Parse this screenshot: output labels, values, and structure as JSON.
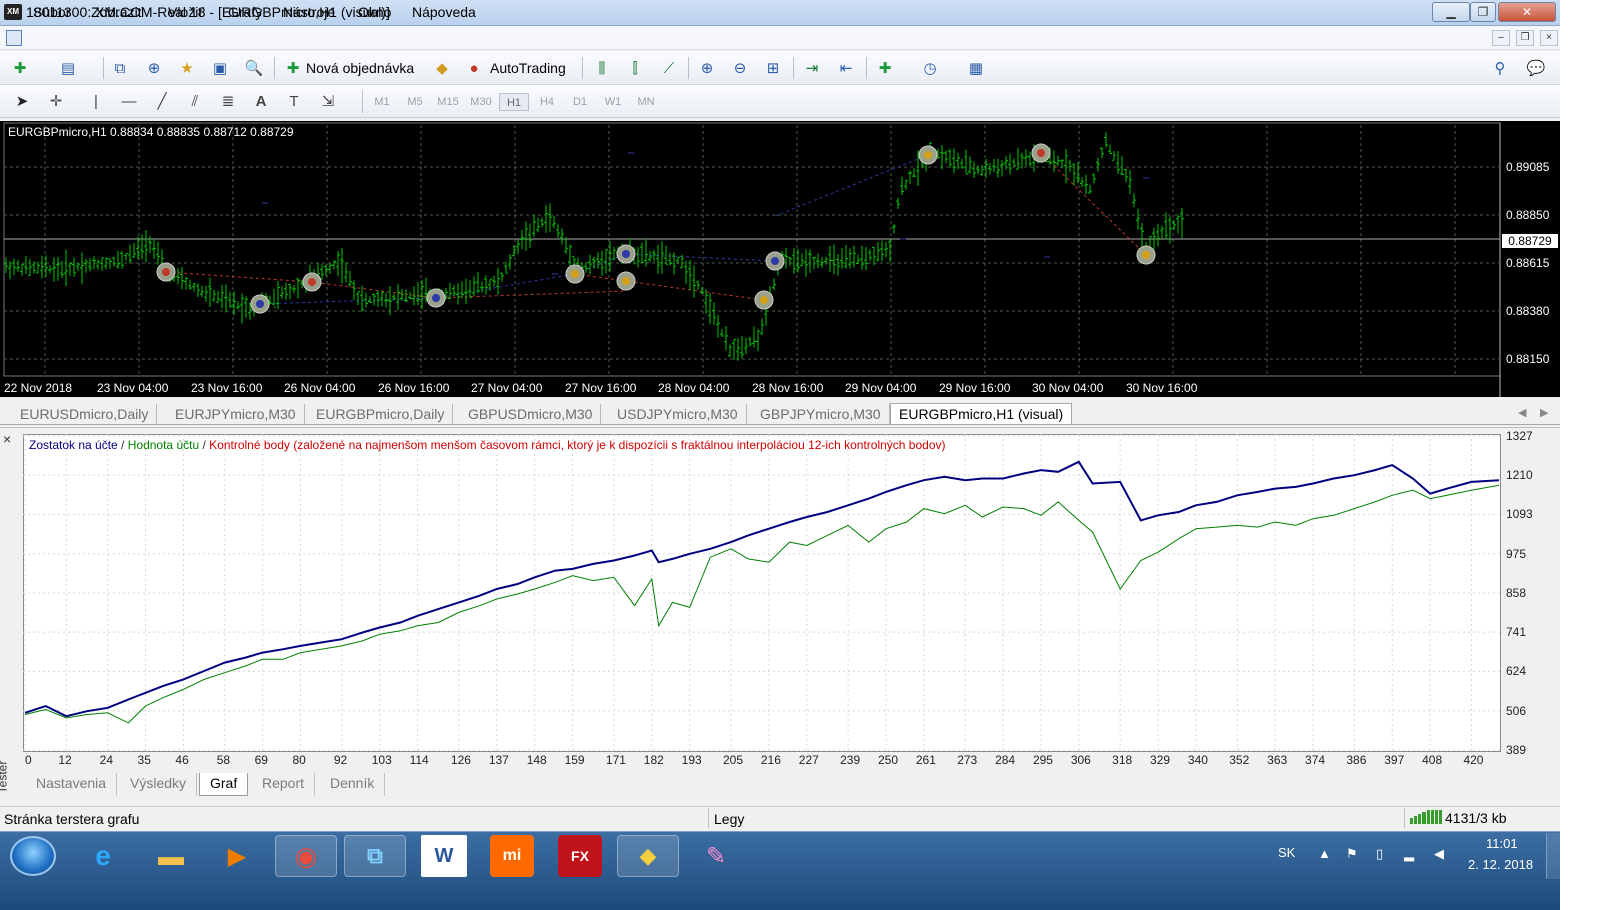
{
  "window": {
    "app_icon": "XM",
    "title": "18011300: XM.COM-Real 18 - [EURGBPmicro,H1 (visual)]",
    "minimize_icon": "minimize-icon",
    "maximize_icon": "maximize-icon",
    "close_icon": "close-icon"
  },
  "menu": {
    "items": [
      "Súbor",
      "Zobraziť",
      "Vložiť",
      "Grafy",
      "Nástroje",
      "Okno",
      "Nápoveda"
    ]
  },
  "toolbar": {
    "new_order_label": "Nová objednávka",
    "autotrading_label": "AutoTrading",
    "timeframes": [
      "M1",
      "M5",
      "M15",
      "M30",
      "H1",
      "H4",
      "D1",
      "W1",
      "MN"
    ],
    "active_timeframe": "H1",
    "text_tool": "A"
  },
  "chart": {
    "info": "EURGBPmicro,H1  0.88834 0.88835 0.88712 0.88729",
    "current_price": "0.88729",
    "price_levels": [
      "0.89085",
      "0.88850",
      "0.88615",
      "0.88380",
      "0.88150"
    ],
    "time_labels": [
      "22 Nov 2018",
      "23 Nov 04:00",
      "23 Nov 16:00",
      "26 Nov 04:00",
      "26 Nov 16:00",
      "27 Nov 04:00",
      "27 Nov 16:00",
      "28 Nov 04:00",
      "28 Nov 16:00",
      "29 Nov 04:00",
      "29 Nov 16:00",
      "30 Nov 04:00",
      "30 Nov 16:00"
    ],
    "colors": {
      "background": "#000000",
      "bull": "#00c800",
      "grid": "#3a4a3a",
      "text": "#ffffff"
    }
  },
  "chart_tabs": [
    "EURUSDmicro,Daily",
    "EURJPYmicro,M30",
    "EURGBPmicro,Daily",
    "GBPUSDmicro,M30",
    "USDJPYmicro,M30",
    "GBPJPYmicro,M30",
    "EURGBPmicro,H1 (visual)"
  ],
  "active_chart_tab": "EURGBPmicro,H1 (visual)",
  "tester": {
    "side_label": "Tester",
    "close_icon": "×",
    "legend": {
      "balance": "Zostatok na účte",
      "equity": "Hodnota účtu",
      "control": "Kontrolné body (založené na najmenšom menšom časovom rámci, ktorý je k dispozícii s fraktálnou interpoláciou 12-ich kontrolných bodov)",
      "separator": " / "
    },
    "tabs": [
      "Nastavenia",
      "Výsledky",
      "Graf",
      "Report",
      "Denník"
    ],
    "active_tab": "Graf"
  },
  "chart_data": {
    "type": "line",
    "title": "",
    "xlabel": "",
    "ylabel": "",
    "x_ticks": [
      0,
      12,
      24,
      35,
      46,
      58,
      69,
      80,
      92,
      103,
      114,
      126,
      137,
      148,
      159,
      171,
      182,
      193,
      205,
      216,
      227,
      239,
      250,
      261,
      273,
      284,
      295,
      306,
      318,
      329,
      340,
      352,
      363,
      374,
      386,
      397,
      408,
      420
    ],
    "y_ticks": [
      1327,
      1210,
      1093,
      975,
      858,
      741,
      624,
      506,
      389
    ],
    "xlim": [
      0,
      428
    ],
    "ylim": [
      389,
      1327
    ],
    "series": [
      {
        "name": "Zostatok na účte",
        "color": "#000080",
        "x": [
          0,
          6,
          12,
          18,
          24,
          30,
          35,
          40,
          46,
          52,
          58,
          64,
          69,
          75,
          80,
          86,
          92,
          98,
          103,
          109,
          114,
          120,
          126,
          132,
          137,
          143,
          148,
          154,
          159,
          165,
          171,
          177,
          182,
          184,
          188,
          193,
          199,
          205,
          210,
          216,
          222,
          227,
          233,
          239,
          245,
          250,
          256,
          261,
          267,
          273,
          278,
          284,
          290,
          295,
          300,
          306,
          310,
          318,
          324,
          329,
          335,
          340,
          346,
          352,
          358,
          363,
          369,
          374,
          380,
          386,
          392,
          397,
          403,
          408,
          413,
          420,
          428
        ],
        "values": [
          500,
          520,
          490,
          505,
          515,
          540,
          560,
          580,
          600,
          625,
          650,
          665,
          680,
          690,
          700,
          710,
          720,
          740,
          755,
          770,
          790,
          810,
          830,
          850,
          870,
          885,
          905,
          925,
          930,
          945,
          955,
          970,
          985,
          950,
          960,
          975,
          990,
          1010,
          1030,
          1050,
          1070,
          1085,
          1100,
          1120,
          1140,
          1160,
          1180,
          1195,
          1205,
          1195,
          1200,
          1200,
          1215,
          1225,
          1220,
          1250,
          1185,
          1190,
          1075,
          1090,
          1100,
          1120,
          1130,
          1150,
          1160,
          1170,
          1175,
          1185,
          1200,
          1210,
          1225,
          1240,
          1200,
          1155,
          1170,
          1190,
          1195
        ]
      },
      {
        "name": "Hodnota účtu",
        "color": "#008000",
        "x": [
          0,
          6,
          12,
          18,
          24,
          30,
          35,
          40,
          46,
          52,
          58,
          64,
          69,
          75,
          80,
          86,
          92,
          98,
          103,
          109,
          114,
          120,
          126,
          132,
          137,
          143,
          148,
          154,
          159,
          165,
          171,
          177,
          182,
          184,
          188,
          193,
          199,
          205,
          210,
          216,
          222,
          227,
          233,
          239,
          245,
          250,
          256,
          261,
          267,
          273,
          278,
          284,
          290,
          295,
          300,
          306,
          310,
          318,
          324,
          329,
          335,
          340,
          346,
          352,
          358,
          363,
          369,
          374,
          380,
          386,
          392,
          397,
          403,
          408,
          413,
          420,
          428
        ],
        "values": [
          495,
          510,
          485,
          495,
          500,
          470,
          520,
          545,
          570,
          600,
          620,
          640,
          660,
          660,
          680,
          690,
          700,
          715,
          735,
          745,
          760,
          770,
          800,
          820,
          840,
          855,
          870,
          890,
          910,
          895,
          905,
          820,
          900,
          760,
          830,
          815,
          965,
          990,
          960,
          950,
          1010,
          1000,
          1030,
          1060,
          1010,
          1050,
          1070,
          1110,
          1095,
          1120,
          1085,
          1115,
          1110,
          1090,
          1130,
          1075,
          1040,
          870,
          955,
          980,
          1020,
          1050,
          1055,
          1060,
          1055,
          1070,
          1060,
          1080,
          1090,
          1110,
          1130,
          1150,
          1165,
          1140,
          1150,
          1165,
          1180
        ]
      }
    ]
  }
}
